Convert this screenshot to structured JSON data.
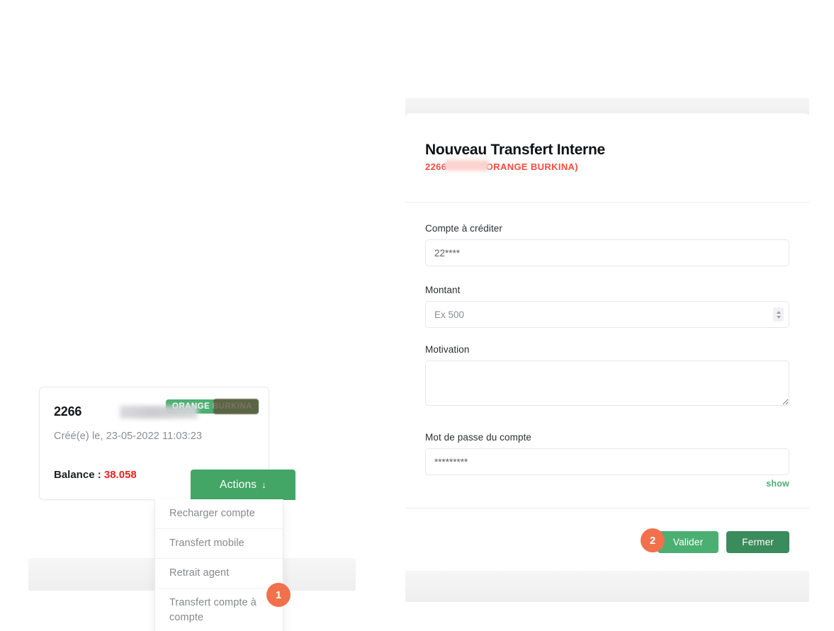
{
  "account_card": {
    "msisdn": "2266",
    "badge_label": "ORANGE BURKINA",
    "created_label": "Créé(e) le, 23-05-2022 11:03:23",
    "balance_label": "Balance : ",
    "balance_value": "38.058",
    "actions_button_label": "Actions",
    "actions_caret": "↓"
  },
  "actions_dropdown": {
    "items": [
      {
        "label": "Recharger compte"
      },
      {
        "label": "Transfert mobile"
      },
      {
        "label": "Retrait agent"
      },
      {
        "label": "Transfert compte à compte"
      }
    ]
  },
  "steps": {
    "one": "1",
    "two": "2"
  },
  "modal": {
    "title": "Nouveau Transfert Interne",
    "subtitle": "2266              ORANGE BURKINA)",
    "fields": {
      "account_to_credit": {
        "label": "Compte à créditer",
        "value": "22****",
        "placeholder": "22****"
      },
      "amount": {
        "label": "Montant",
        "value": "",
        "placeholder": "Ex 500"
      },
      "motivation": {
        "label": "Motivation",
        "value": "",
        "placeholder": ""
      },
      "password": {
        "label": "Mot de passe du compte",
        "value": "*********",
        "placeholder": "*********",
        "show_link_label": "show"
      }
    },
    "footer": {
      "validate_label": "Valider",
      "close_label": "Fermer"
    }
  },
  "colors": {
    "green_primary": "#4caf72",
    "green_dark": "#3b8c5c",
    "orange_badge": "#f2704c",
    "red_amount": "#f01f1f",
    "red_subtitle": "#fa4b3c"
  }
}
